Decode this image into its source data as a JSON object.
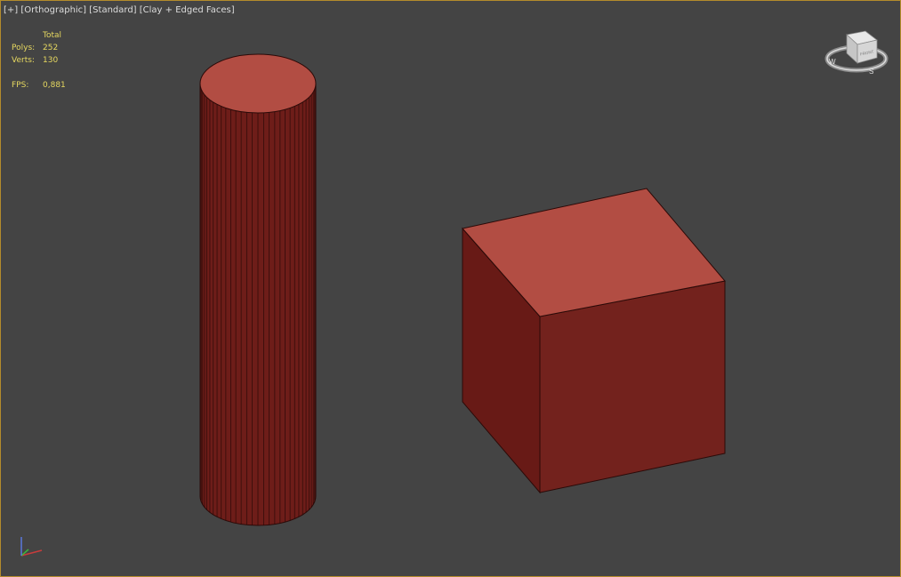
{
  "viewport": {
    "label_plus": "[+]",
    "label_view": "[Orthographic]",
    "label_shading_mode": "[Standard]",
    "label_shading": "[Clay + Edged Faces]",
    "border_color": "#b48c2c",
    "background_color": "#444444"
  },
  "stats": {
    "header": "Total",
    "polys_label": "Polys:",
    "polys_value": "252",
    "verts_label": "Verts:",
    "verts_value": "130",
    "fps_label": "FPS:",
    "fps_value": "0,881",
    "color": "#e6d860"
  },
  "viewcube": {
    "face_label": "FRONT",
    "compass": {
      "west": "W",
      "south": "S"
    }
  },
  "objects": {
    "cylinder": {
      "side_color": "#6e1d19",
      "cap_color": "#b24d43",
      "edge_color": "#2b0a08",
      "segments": 64
    },
    "box": {
      "top_color": "#b24d43",
      "front_color": "#73221d",
      "left_color": "#681a16",
      "edge_color": "#2b0a08"
    }
  },
  "axis_tripod": {
    "x_color": "#c83c3c",
    "y_color": "#3cb43c",
    "z_color": "#5a78dc"
  }
}
